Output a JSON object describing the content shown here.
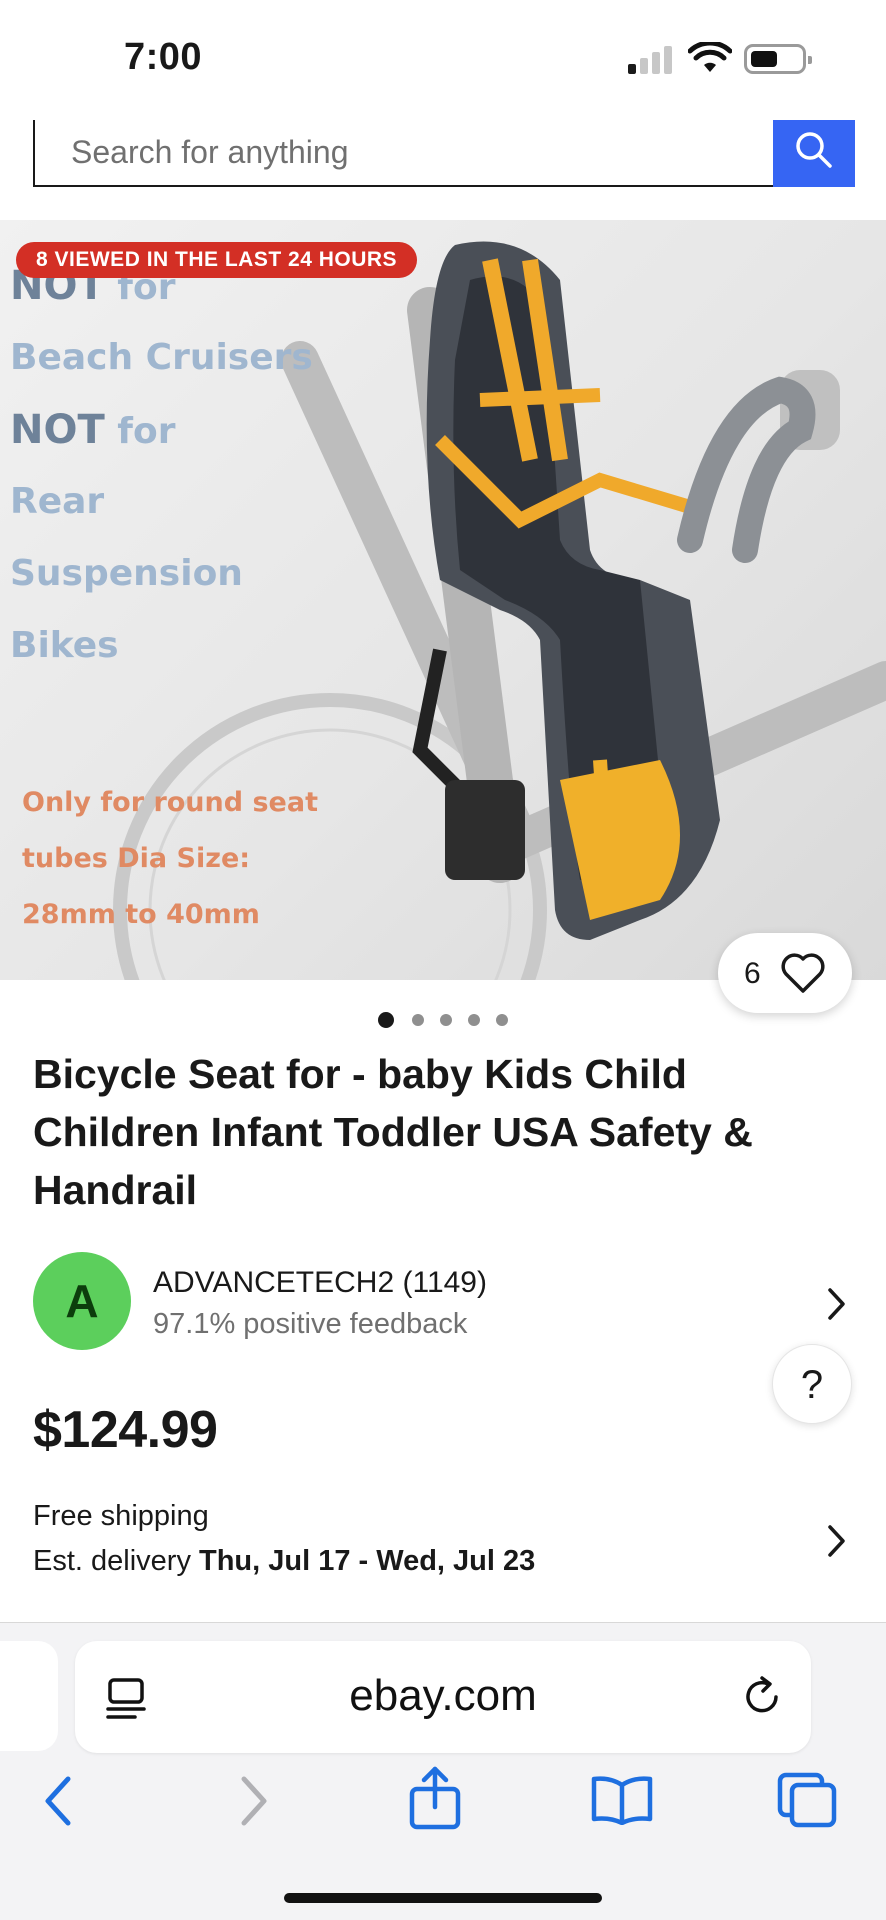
{
  "status_bar": {
    "time": "7:00"
  },
  "search": {
    "placeholder": "Search for anything"
  },
  "hero": {
    "badge": "8 VIEWED IN THE LAST 24 HOURS",
    "overlay_lines": [
      {
        "strong": "NOT",
        "rest": " for"
      },
      {
        "strong": "",
        "rest": "Beach Cruisers"
      },
      {
        "strong": "NOT",
        "rest": " for"
      },
      {
        "strong": "",
        "rest": "Rear"
      },
      {
        "strong": "",
        "rest": "Suspension"
      },
      {
        "strong": "",
        "rest": "Bikes"
      }
    ],
    "note_lines": [
      "Only for round seat",
      "tubes Dia Size:",
      "28mm to 40mm"
    ],
    "watch_count": "6",
    "image_count": 5,
    "active_image": 1
  },
  "product": {
    "title": "Bicycle Seat for - baby Kids Child Children Infant Toddler USA Safety & Handrail",
    "price": "$124.99"
  },
  "seller": {
    "initial": "A",
    "name": "ADVANCETECH2 (1149)",
    "feedback": "97.1% positive feedback"
  },
  "shipping": {
    "line1": "Free shipping",
    "delivery_prefix": "Est. delivery ",
    "delivery_dates": "Thu, Jul 17 - Wed, Jul 23"
  },
  "help": {
    "label": "?"
  },
  "browser": {
    "url": "ebay.com"
  },
  "colors": {
    "ebay_blue": "#3665f3",
    "badge_red": "#d32f25",
    "avatar_green": "#5ccf5c",
    "ios_blue": "#1e6fe0"
  },
  "icons": [
    "search-icon",
    "heart-icon",
    "chevron-right-icon",
    "reader-icon",
    "reload-icon",
    "back-icon",
    "forward-icon",
    "share-icon",
    "bookmarks-icon",
    "tabs-icon"
  ]
}
